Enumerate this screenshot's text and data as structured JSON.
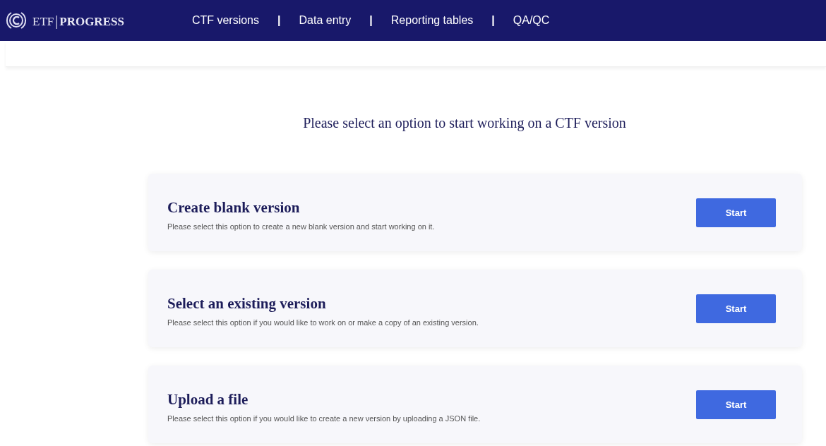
{
  "navbar": {
    "logo": {
      "left": "ETF",
      "divider": "|",
      "right": "PROGRESS"
    },
    "menu": [
      {
        "label": "CTF versions"
      },
      {
        "label": "Data entry"
      },
      {
        "label": "Reporting tables"
      },
      {
        "label": "QA/QC"
      }
    ],
    "separator": "|"
  },
  "heading": "Please select an option to start working on a CTF version",
  "options": [
    {
      "title": "Create blank version",
      "description": "Please select this option to create a new blank version and start working on it.",
      "button": "Start"
    },
    {
      "title": "Select an existing version",
      "description": "Please select this option if you would like to work on or make a copy of an existing version.",
      "button": "Start"
    },
    {
      "title": "Upload a file",
      "description": "Please select this option if you would like to create a new version by uploading a JSON file.",
      "button": "Start"
    }
  ]
}
